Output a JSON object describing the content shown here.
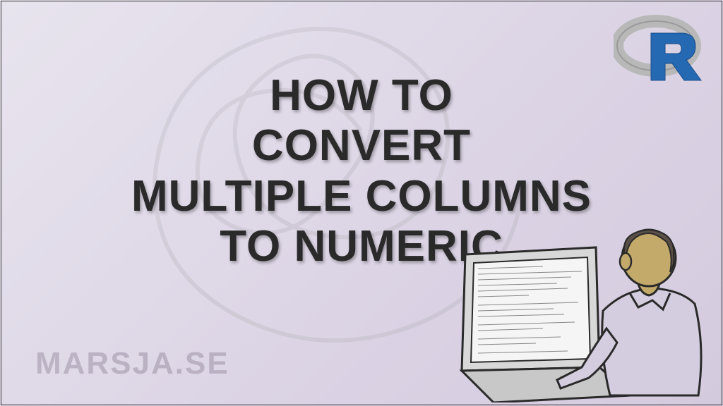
{
  "title": {
    "line1": "HOW TO",
    "line2": "CONVERT",
    "line3": "MULTIPLE COLUMNS",
    "line4": "TO NUMERIC"
  },
  "watermark": "MARSJA.SE",
  "logo": {
    "name": "r-language-logo"
  },
  "illustration": {
    "name": "person-at-laptop"
  }
}
